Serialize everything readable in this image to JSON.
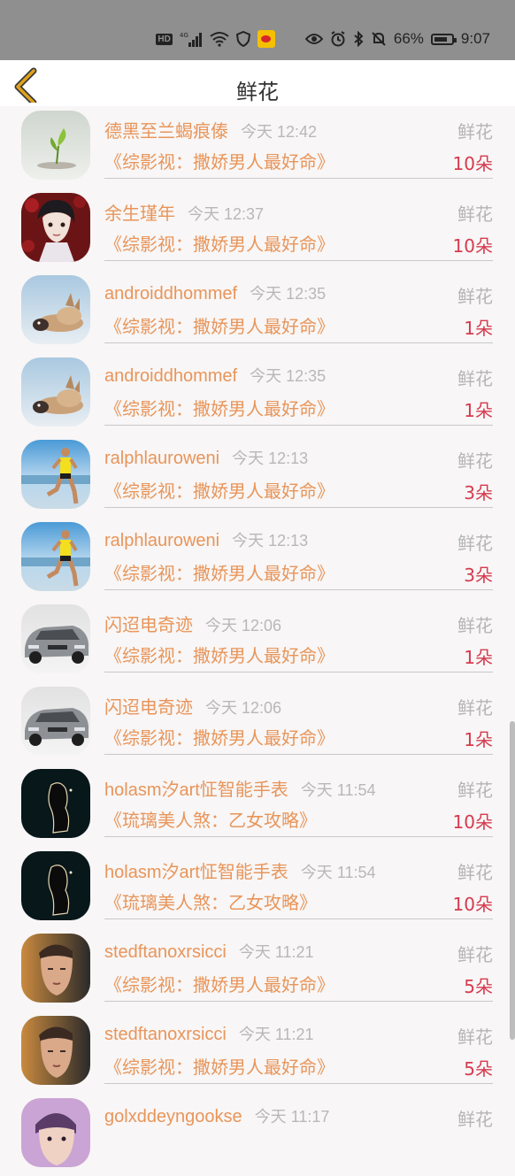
{
  "status": {
    "battery": "66%",
    "time": "9:07",
    "hd": "HD",
    "signal_type": "4G"
  },
  "header": {
    "title": "鲜花"
  },
  "rows": [
    {
      "name": "德黑至兰蝎痕傣",
      "time": "今天 12:42",
      "gift": "鲜花",
      "book": "《综影视：撒娇男人最好命》",
      "count": "10朵",
      "avatar": "plant"
    },
    {
      "name": "余生瑾年",
      "time": "今天 12:37",
      "gift": "鲜花",
      "book": "《综影视：撒娇男人最好命》",
      "count": "10朵",
      "avatar": "anime"
    },
    {
      "name": "androiddhommef",
      "time": "今天 12:35",
      "gift": "鲜花",
      "book": "《综影视：撒娇男人最好命》",
      "count": "1朵",
      "avatar": "cat"
    },
    {
      "name": "androiddhommef",
      "time": "今天 12:35",
      "gift": "鲜花",
      "book": "《综影视：撒娇男人最好命》",
      "count": "1朵",
      "avatar": "cat"
    },
    {
      "name": "ralphlauroweni",
      "time": "今天 12:13",
      "gift": "鲜花",
      "book": "《综影视：撒娇男人最好命》",
      "count": "3朵",
      "avatar": "runner"
    },
    {
      "name": "ralphlauroweni",
      "time": "今天 12:13",
      "gift": "鲜花",
      "book": "《综影视：撒娇男人最好命》",
      "count": "3朵",
      "avatar": "runner"
    },
    {
      "name": "闪迢电奇迹",
      "time": "今天 12:06",
      "gift": "鲜花",
      "book": "《综影视：撒娇男人最好命》",
      "count": "1朵",
      "avatar": "car"
    },
    {
      "name": "闪迢电奇迹",
      "time": "今天 12:06",
      "gift": "鲜花",
      "book": "《综影视：撒娇男人最好命》",
      "count": "1朵",
      "avatar": "car"
    },
    {
      "name": "holasm汐art怔智能手表",
      "time": "今天 11:54",
      "gift": "鲜花",
      "book": "《琉璃美人煞：乙女攻略》",
      "count": "10朵",
      "avatar": "silhouette"
    },
    {
      "name": "holasm汐art怔智能手表",
      "time": "今天 11:54",
      "gift": "鲜花",
      "book": "《琉璃美人煞：乙女攻略》",
      "count": "10朵",
      "avatar": "silhouette"
    },
    {
      "name": "stedftanoxrsicci",
      "time": "今天 11:21",
      "gift": "鲜花",
      "book": "《综影视：撒娇男人最好命》",
      "count": "5朵",
      "avatar": "face"
    },
    {
      "name": "stedftanoxrsicci",
      "time": "今天 11:21",
      "gift": "鲜花",
      "book": "《综影视：撒娇男人最好命》",
      "count": "5朵",
      "avatar": "face"
    },
    {
      "name": "golxddeyngookse",
      "time": "今天 11:17",
      "gift": "鲜花",
      "book": "",
      "count": "",
      "avatar": "face2"
    }
  ],
  "colors": {
    "name": "#e8955a",
    "count": "#d63a4e",
    "gift": "#b5b5b5",
    "time": "#b8b8b8",
    "back_arrow": "#e0a11b"
  }
}
